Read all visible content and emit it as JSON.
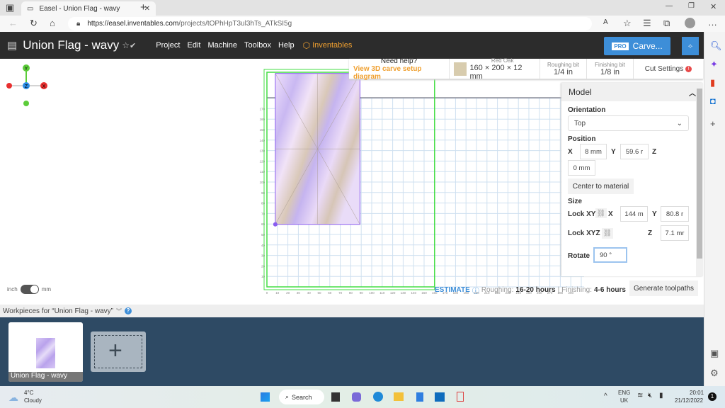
{
  "browser": {
    "tab_title": "Easel - Union Flag - wavy",
    "url_host": "https://easel.inventables.com",
    "url_path": "/projects/tOPhHpT3ul3hTs_ATkSI5g"
  },
  "header": {
    "title": "Union Flag - wavy",
    "menu": [
      "Project",
      "Edit",
      "Machine",
      "Toolbox",
      "Help"
    ],
    "brand": "Inventables",
    "carve_pro": "PRO",
    "carve_label": "Carve..."
  },
  "infobar": {
    "help": "Need help?",
    "help_link": "View 3D carve setup diagram",
    "material": "Red Oak",
    "material_size": "160 × 200 × 12 mm",
    "roughing_label": "Roughing bit",
    "roughing_value": "1/4 in",
    "finishing_label": "Finishing bit",
    "finishing_value": "1/8 in",
    "cut_settings": "Cut Settings"
  },
  "panel": {
    "title": "Model",
    "orientation_label": "Orientation",
    "orientation_value": "Top",
    "position_label": "Position",
    "x_label": "X",
    "x_value": "8 mm",
    "y_label": "Y",
    "y_value": "59.6 r",
    "z_label": "Z",
    "z_value": "0 mm",
    "center_btn": "Center to material",
    "size_label": "Size",
    "lock_xy": "Lock XY",
    "size_x": "144 m",
    "size_y": "80.8 r",
    "lock_xyz": "Lock XYZ",
    "size_z": "7.1 mr",
    "rotate_label": "Rotate",
    "rotate_value": "90 °"
  },
  "canvas": {
    "x_ticks": [
      0,
      10,
      20,
      30,
      40,
      50,
      60,
      70,
      80,
      90,
      100,
      110,
      120,
      130,
      140,
      150,
      160,
      170,
      180,
      190,
      200,
      210,
      220,
      230,
      240,
      250,
      260,
      270,
      280,
      290
    ],
    "y_ticks": [
      10,
      20,
      30,
      40,
      50,
      60,
      70,
      80,
      90,
      100,
      110,
      120,
      130,
      140,
      150,
      160,
      170
    ],
    "axis_y": "Y",
    "axis_z": "Z",
    "axis_x": "X"
  },
  "estimate": {
    "label": "ESTIMATE",
    "roughing": "Roughing:",
    "roughing_time": "16-20 hours",
    "sep": "|",
    "finishing": "Finishing:",
    "finishing_time": "4-6 hours",
    "generate": "Generate toolpaths"
  },
  "units": {
    "inch": "inch",
    "mm": "mm",
    "selected": "mm"
  },
  "workpieces": {
    "header": "Workpieces for “Union Flag - wavy”",
    "items": [
      {
        "name": "Union Flag - wavy"
      }
    ]
  },
  "taskbar": {
    "temp": "4°C",
    "weather": "Cloudy",
    "search": "Search",
    "lang1": "ENG",
    "lang2": "UK",
    "time": "20:01",
    "date": "21/12/2022",
    "notif": "1"
  },
  "colors": {
    "accent": "#3d8ed8",
    "brand": "#f0a030",
    "header": "#2c2c2c",
    "workpiece_bg": "#2e4a64",
    "bounds": "#44dd44",
    "model": "#8a5cf0"
  }
}
